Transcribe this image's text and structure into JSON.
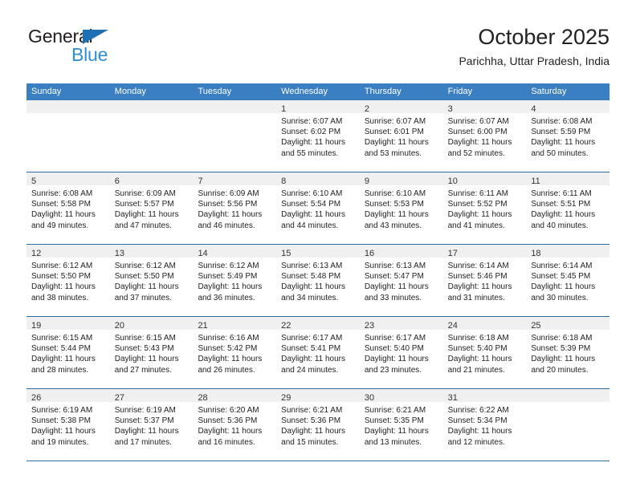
{
  "brand": {
    "name_top": "General",
    "name_bottom": "Blue",
    "color_dark": "#231f20",
    "color_blue": "#2d8fd5",
    "triangle_color": "#1f6fb5"
  },
  "header": {
    "title": "October 2025",
    "subtitle": "Parichha, Uttar Pradesh, India"
  },
  "theme": {
    "header_bg": "#3a7fc1",
    "row_rule": "#2e6da4",
    "day_band": "#f0f0f0",
    "text": "#222222"
  },
  "weekdays": [
    "Sunday",
    "Monday",
    "Tuesday",
    "Wednesday",
    "Thursday",
    "Friday",
    "Saturday"
  ],
  "weeks": [
    [
      {
        "day": "",
        "lines": []
      },
      {
        "day": "",
        "lines": []
      },
      {
        "day": "",
        "lines": []
      },
      {
        "day": "1",
        "lines": [
          "Sunrise: 6:07 AM",
          "Sunset: 6:02 PM",
          "Daylight: 11 hours",
          "and 55 minutes."
        ]
      },
      {
        "day": "2",
        "lines": [
          "Sunrise: 6:07 AM",
          "Sunset: 6:01 PM",
          "Daylight: 11 hours",
          "and 53 minutes."
        ]
      },
      {
        "day": "3",
        "lines": [
          "Sunrise: 6:07 AM",
          "Sunset: 6:00 PM",
          "Daylight: 11 hours",
          "and 52 minutes."
        ]
      },
      {
        "day": "4",
        "lines": [
          "Sunrise: 6:08 AM",
          "Sunset: 5:59 PM",
          "Daylight: 11 hours",
          "and 50 minutes."
        ]
      }
    ],
    [
      {
        "day": "5",
        "lines": [
          "Sunrise: 6:08 AM",
          "Sunset: 5:58 PM",
          "Daylight: 11 hours",
          "and 49 minutes."
        ]
      },
      {
        "day": "6",
        "lines": [
          "Sunrise: 6:09 AM",
          "Sunset: 5:57 PM",
          "Daylight: 11 hours",
          "and 47 minutes."
        ]
      },
      {
        "day": "7",
        "lines": [
          "Sunrise: 6:09 AM",
          "Sunset: 5:56 PM",
          "Daylight: 11 hours",
          "and 46 minutes."
        ]
      },
      {
        "day": "8",
        "lines": [
          "Sunrise: 6:10 AM",
          "Sunset: 5:54 PM",
          "Daylight: 11 hours",
          "and 44 minutes."
        ]
      },
      {
        "day": "9",
        "lines": [
          "Sunrise: 6:10 AM",
          "Sunset: 5:53 PM",
          "Daylight: 11 hours",
          "and 43 minutes."
        ]
      },
      {
        "day": "10",
        "lines": [
          "Sunrise: 6:11 AM",
          "Sunset: 5:52 PM",
          "Daylight: 11 hours",
          "and 41 minutes."
        ]
      },
      {
        "day": "11",
        "lines": [
          "Sunrise: 6:11 AM",
          "Sunset: 5:51 PM",
          "Daylight: 11 hours",
          "and 40 minutes."
        ]
      }
    ],
    [
      {
        "day": "12",
        "lines": [
          "Sunrise: 6:12 AM",
          "Sunset: 5:50 PM",
          "Daylight: 11 hours",
          "and 38 minutes."
        ]
      },
      {
        "day": "13",
        "lines": [
          "Sunrise: 6:12 AM",
          "Sunset: 5:50 PM",
          "Daylight: 11 hours",
          "and 37 minutes."
        ]
      },
      {
        "day": "14",
        "lines": [
          "Sunrise: 6:12 AM",
          "Sunset: 5:49 PM",
          "Daylight: 11 hours",
          "and 36 minutes."
        ]
      },
      {
        "day": "15",
        "lines": [
          "Sunrise: 6:13 AM",
          "Sunset: 5:48 PM",
          "Daylight: 11 hours",
          "and 34 minutes."
        ]
      },
      {
        "day": "16",
        "lines": [
          "Sunrise: 6:13 AM",
          "Sunset: 5:47 PM",
          "Daylight: 11 hours",
          "and 33 minutes."
        ]
      },
      {
        "day": "17",
        "lines": [
          "Sunrise: 6:14 AM",
          "Sunset: 5:46 PM",
          "Daylight: 11 hours",
          "and 31 minutes."
        ]
      },
      {
        "day": "18",
        "lines": [
          "Sunrise: 6:14 AM",
          "Sunset: 5:45 PM",
          "Daylight: 11 hours",
          "and 30 minutes."
        ]
      }
    ],
    [
      {
        "day": "19",
        "lines": [
          "Sunrise: 6:15 AM",
          "Sunset: 5:44 PM",
          "Daylight: 11 hours",
          "and 28 minutes."
        ]
      },
      {
        "day": "20",
        "lines": [
          "Sunrise: 6:15 AM",
          "Sunset: 5:43 PM",
          "Daylight: 11 hours",
          "and 27 minutes."
        ]
      },
      {
        "day": "21",
        "lines": [
          "Sunrise: 6:16 AM",
          "Sunset: 5:42 PM",
          "Daylight: 11 hours",
          "and 26 minutes."
        ]
      },
      {
        "day": "22",
        "lines": [
          "Sunrise: 6:17 AM",
          "Sunset: 5:41 PM",
          "Daylight: 11 hours",
          "and 24 minutes."
        ]
      },
      {
        "day": "23",
        "lines": [
          "Sunrise: 6:17 AM",
          "Sunset: 5:40 PM",
          "Daylight: 11 hours",
          "and 23 minutes."
        ]
      },
      {
        "day": "24",
        "lines": [
          "Sunrise: 6:18 AM",
          "Sunset: 5:40 PM",
          "Daylight: 11 hours",
          "and 21 minutes."
        ]
      },
      {
        "day": "25",
        "lines": [
          "Sunrise: 6:18 AM",
          "Sunset: 5:39 PM",
          "Daylight: 11 hours",
          "and 20 minutes."
        ]
      }
    ],
    [
      {
        "day": "26",
        "lines": [
          "Sunrise: 6:19 AM",
          "Sunset: 5:38 PM",
          "Daylight: 11 hours",
          "and 19 minutes."
        ]
      },
      {
        "day": "27",
        "lines": [
          "Sunrise: 6:19 AM",
          "Sunset: 5:37 PM",
          "Daylight: 11 hours",
          "and 17 minutes."
        ]
      },
      {
        "day": "28",
        "lines": [
          "Sunrise: 6:20 AM",
          "Sunset: 5:36 PM",
          "Daylight: 11 hours",
          "and 16 minutes."
        ]
      },
      {
        "day": "29",
        "lines": [
          "Sunrise: 6:21 AM",
          "Sunset: 5:36 PM",
          "Daylight: 11 hours",
          "and 15 minutes."
        ]
      },
      {
        "day": "30",
        "lines": [
          "Sunrise: 6:21 AM",
          "Sunset: 5:35 PM",
          "Daylight: 11 hours",
          "and 13 minutes."
        ]
      },
      {
        "day": "31",
        "lines": [
          "Sunrise: 6:22 AM",
          "Sunset: 5:34 PM",
          "Daylight: 11 hours",
          "and 12 minutes."
        ]
      },
      {
        "day": "",
        "lines": []
      }
    ]
  ]
}
